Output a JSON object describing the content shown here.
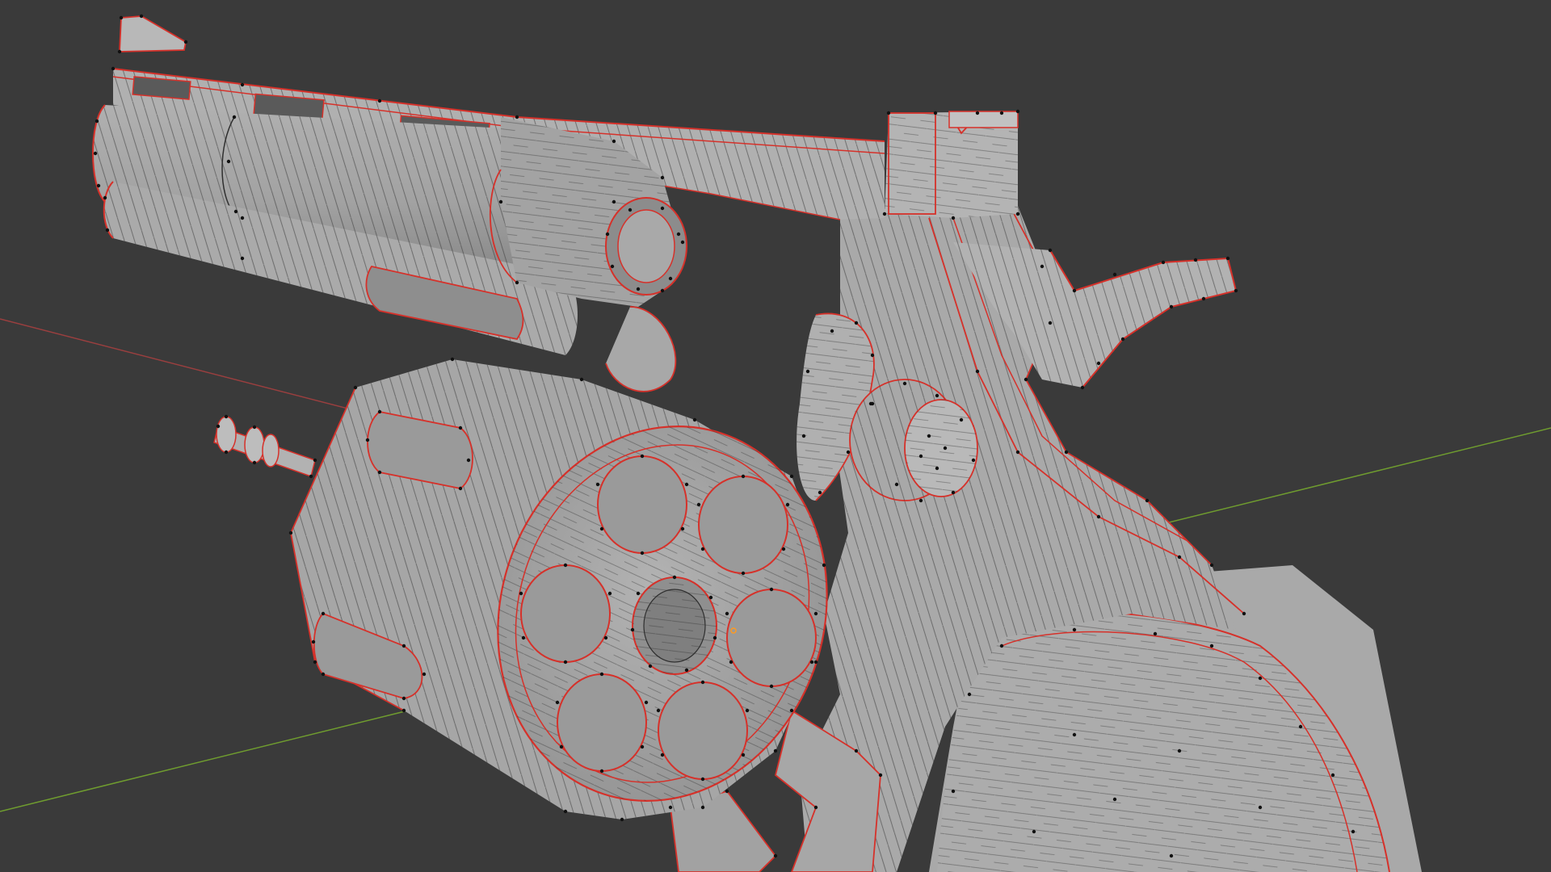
{
  "viewport": {
    "background_color": "#3a3a3a",
    "axis_x_color": "#9a3f3f",
    "axis_y_color": "#6f9c2f",
    "mesh_face_color": "#a8a8a8",
    "mesh_shade_color": "#8c8c8c",
    "mesh_light_color": "#bdbdbd",
    "wire_color": "#2f2f2f",
    "seam_color": "#d6312a",
    "vertex_color": "#111111",
    "origin_color": "#ff9a1f"
  },
  "mesh": {
    "object": "revolver",
    "parts": [
      "barrel",
      "ejector-rod-housing",
      "top-rib",
      "front-sight",
      "rear-sight",
      "frame",
      "cylinder",
      "cylinder-chambers",
      "ejector-rod",
      "crane",
      "hammer",
      "cylinder-release",
      "trigger-guard",
      "grip"
    ]
  }
}
